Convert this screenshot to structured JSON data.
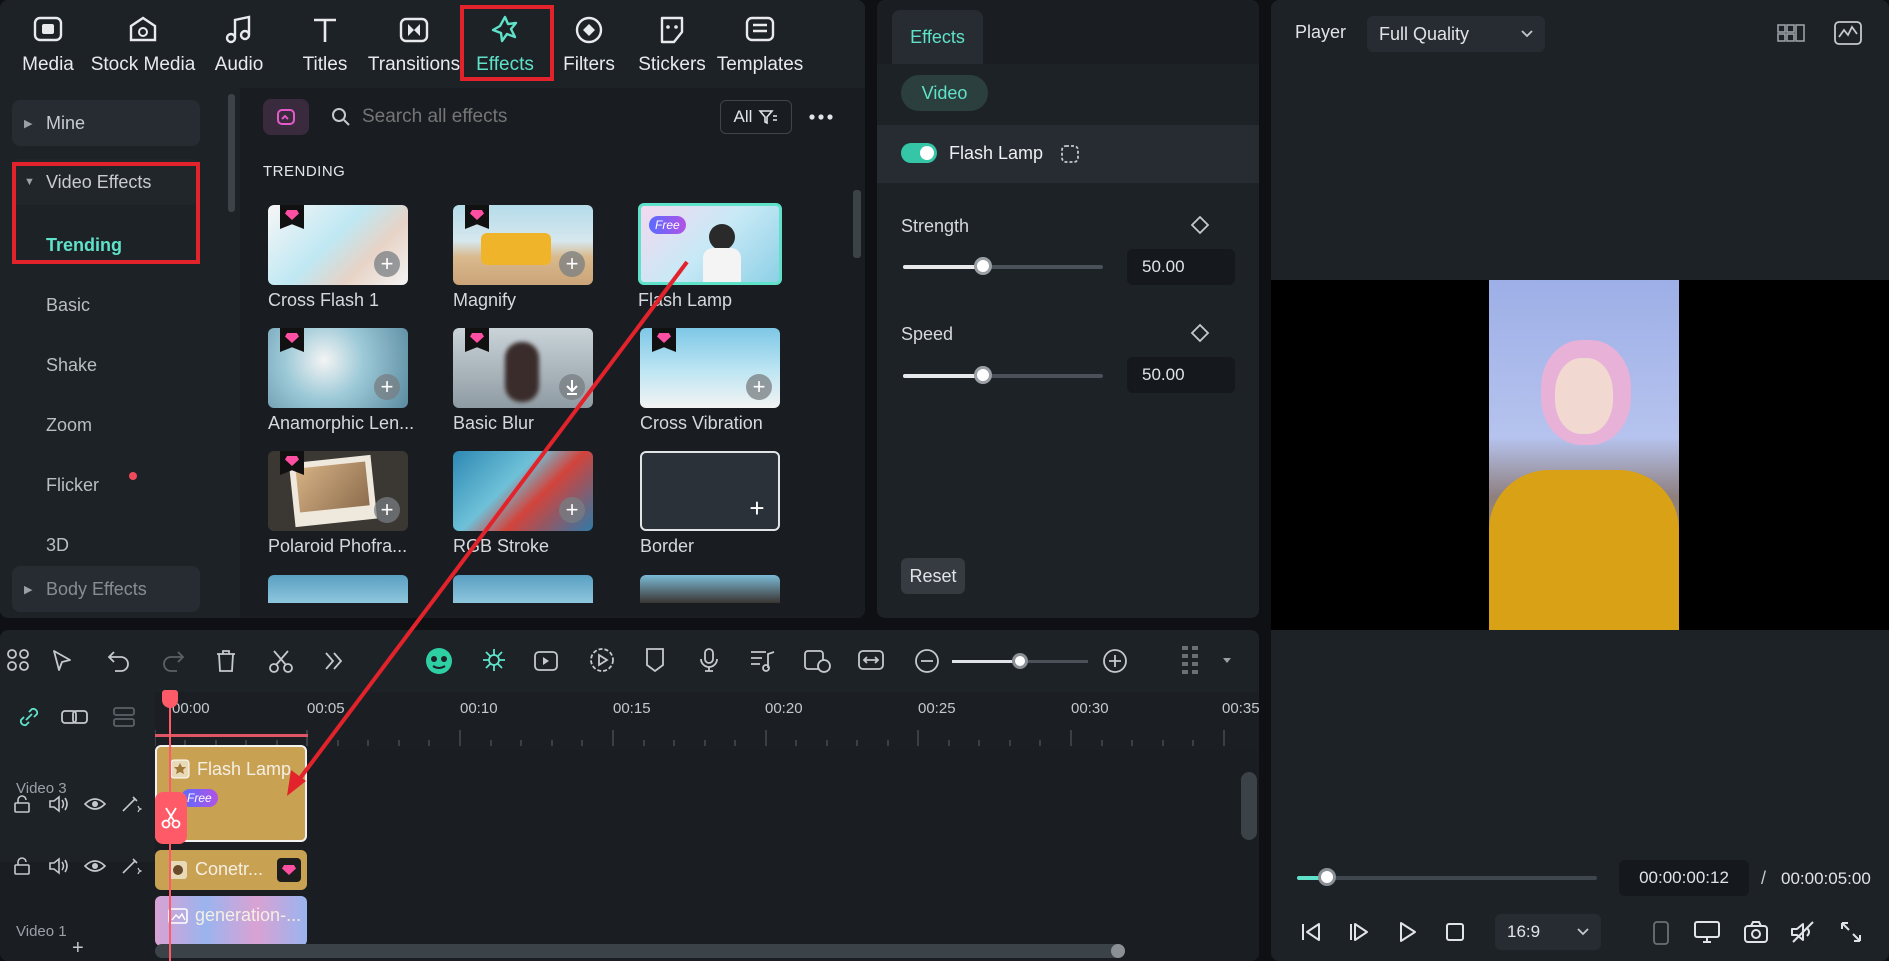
{
  "nav": {
    "tabs": [
      {
        "label": "Media",
        "icon": "media-icon"
      },
      {
        "label": "Stock Media",
        "icon": "stock-media-icon"
      },
      {
        "label": "Audio",
        "icon": "audio-icon"
      },
      {
        "label": "Titles",
        "icon": "titles-icon"
      },
      {
        "label": "Transitions",
        "icon": "transitions-icon"
      },
      {
        "label": "Effects",
        "icon": "effects-icon"
      },
      {
        "label": "Filters",
        "icon": "filters-icon"
      },
      {
        "label": "Stickers",
        "icon": "stickers-icon"
      },
      {
        "label": "Templates",
        "icon": "templates-icon"
      }
    ],
    "active_tab": "Effects"
  },
  "sidebar": {
    "mine": "Mine",
    "video_effects": "Video Effects",
    "items": [
      "Trending",
      "Basic",
      "Shake",
      "Zoom",
      "Flicker",
      "3D"
    ],
    "active_item": "Trending",
    "body_effects": "Body Effects"
  },
  "search": {
    "placeholder": "Search all effects",
    "filter": "All"
  },
  "section_title": "TRENDING",
  "effects": [
    {
      "label": "Cross Flash 1",
      "premium": true
    },
    {
      "label": "Magnify",
      "premium": true
    },
    {
      "label": "Flash Lamp",
      "premium": false,
      "badge": "Free"
    },
    {
      "label": "Anamorphic Len...",
      "premium": true
    },
    {
      "label": "Basic Blur",
      "premium": true
    },
    {
      "label": "Cross Vibration",
      "premium": true
    },
    {
      "label": "Polaroid Phofra...",
      "premium": true
    },
    {
      "label": "RGB Stroke",
      "premium": false
    },
    {
      "label": "Border",
      "premium": false
    }
  ],
  "props": {
    "tab": "Effects",
    "category": "Video",
    "effect_name": "Flash Lamp",
    "enabled": true,
    "params": [
      {
        "label": "Strength",
        "value": "50.00",
        "level": 0.5
      },
      {
        "label": "Speed",
        "value": "50.00",
        "level": 0.5
      }
    ],
    "reset": "Reset"
  },
  "player": {
    "label": "Player",
    "quality": "Full Quality",
    "current_time": "00:00:00:12",
    "separator": "/",
    "total_time": "00:00:05:00",
    "aspect": "16:9",
    "progress": 0.1
  },
  "timeline": {
    "ruler": [
      "00:00",
      "00:05",
      "00:10",
      "00:15",
      "00:20",
      "00:25",
      "00:30",
      "00:35"
    ],
    "tracks": {
      "video3": "Video 3",
      "video1": "Video 1"
    },
    "clips": {
      "effect": {
        "label": "Flash Lamp",
        "badge": "Free"
      },
      "sticker": {
        "label": "Conetr..."
      },
      "video": {
        "label": "generation-..."
      }
    },
    "add": "+"
  },
  "colors": {
    "accent": "#5fe2c9",
    "highlight": "#e3232b",
    "clip_gold": "#c9a152",
    "playhead": "#ff5a67"
  }
}
